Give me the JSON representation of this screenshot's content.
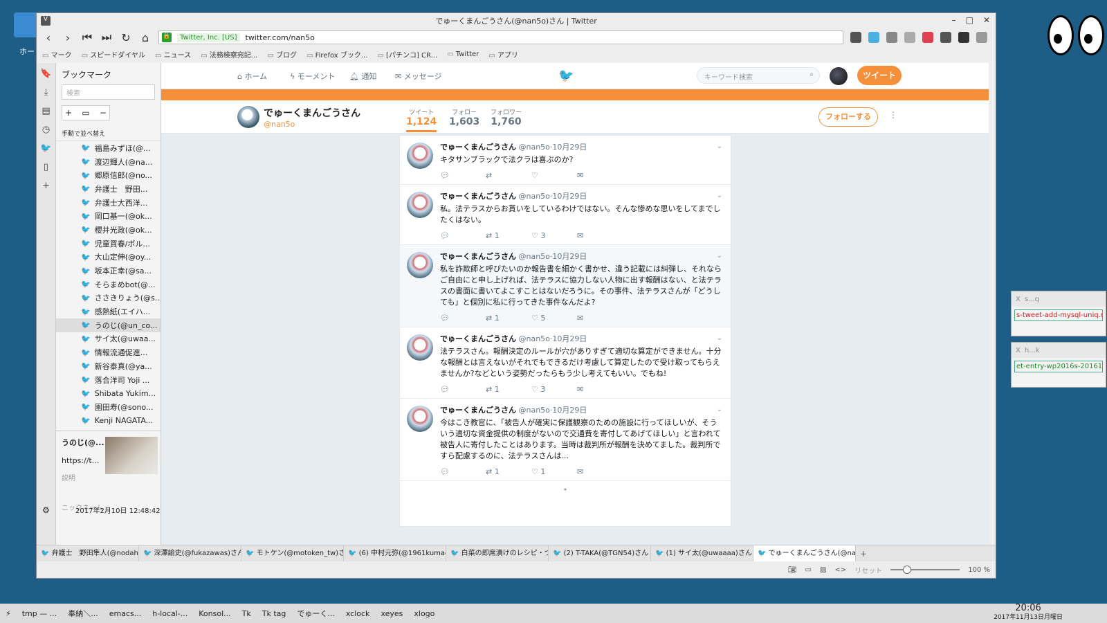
{
  "desktop": {
    "home_label": "ホー"
  },
  "mini_windows": [
    {
      "title": "s...q",
      "content": "s-tweet-add-mysql-uniq.rb"
    },
    {
      "title": "h...k",
      "content": "et-entry-wp2016s-201610"
    }
  ],
  "window": {
    "title": "でゅーくまんごうさん(@nan5o)さん | Twitter",
    "vbadge": "V"
  },
  "address": {
    "cert": "Twitter, Inc. [US]",
    "url": "twitter.com/nan5o"
  },
  "bookmarks": [
    "マーク",
    "スピードダイヤル",
    "ニュース",
    "法務検察宛記...",
    "ブログ",
    "Firefox ブック...",
    "[パチンコ] CR...",
    "Twitter",
    "アプリ"
  ],
  "panel": {
    "title": "ブックマーク",
    "search_placeholder": "検索",
    "sort_label": "手動で並べ替え",
    "items": [
      "福島みずほ(@...",
      "渡辺輝人(@na...",
      "郷原信郎(@no...",
      "弁護士　野田...",
      "弁護士大西洋...",
      "岡口基一(@ok...",
      "櫻井光政(@ok...",
      "児童買春/ポル...",
      "大山定伸(@oy...",
      "坂本正幸(@sa...",
      "そらまめbot(@...",
      "ささきりょう(@s...",
      "感熱紙(エイハ...",
      "うのじ(@un_co...",
      "サイ太(@uwaa...",
      "情報流通促進...",
      "新谷泰真(@ya...",
      "落合洋司 Yoji ...",
      "Shibata Yukim...",
      "園田寿(@sono...",
      "Kenji NAGATA..."
    ],
    "detail_name": "うのじ(@...",
    "detail_url": "https://t...",
    "desc_label": "説明",
    "nick_label": "ニックネーム",
    "date": "2017年2月10日 12:48:42"
  },
  "twitter_nav": {
    "home": "ホーム",
    "moments": "モーメント",
    "notifications": "通知",
    "messages": "メッセージ",
    "search_placeholder": "キーワード検索",
    "tweet_button": "ツイート"
  },
  "profile": {
    "name": "でゅーくまんごうさん",
    "handle": "@nan5o",
    "stats": [
      {
        "label": "ツイート",
        "value": "1,124"
      },
      {
        "label": "フォロー",
        "value": "1,603"
      },
      {
        "label": "フォロワー",
        "value": "1,760"
      }
    ],
    "follow_button": "フォローする"
  },
  "tweets": [
    {
      "name": "でゅーくまんごうさん",
      "handle": "@nan5o",
      "date": "·10月29日",
      "text": "キタサンブラックで法クラは喜ぶのか?",
      "retweets": "",
      "likes": ""
    },
    {
      "name": "でゅーくまんごうさん",
      "handle": "@nan5o",
      "date": "·10月29日",
      "text": "私。法テラスからお貰いをしているわけではない。そんな惨めな思いをしてまでしたくはない。",
      "retweets": "1",
      "likes": "3"
    },
    {
      "name": "でゅーくまんごうさん",
      "handle": "@nan5o",
      "date": "·10月29日",
      "text": "私を詐欺師と呼びたいのか報告書を細かく書かせ、違う記載には糾弾し、それならご自由にと申し上げれば、法テラスに協力しない人物に出す報酬はない、と法テラスの書面に書いてよこすことはないだろうに。その事件、法テラスさんが「どうしても」と個別に私に行ってきた事件なんだよ?",
      "retweets": "1",
      "likes": "5"
    },
    {
      "name": "でゅーくまんごうさん",
      "handle": "@nan5o",
      "date": "·10月29日",
      "text": "法テラスさん。報酬決定のルールが穴がありすぎて適切な算定ができません。十分な報酬とは言えないがそれでもできるだけ考慮して算定したので受け取ってもらえませんか?などという姿勢だったらもう少し考えてもいい。でもね!",
      "retweets": "1",
      "likes": "3"
    },
    {
      "name": "でゅーくまんごうさん",
      "handle": "@nan5o",
      "date": "·10月29日",
      "text": "今はこき教官に、「被告人が確実に保護観察のための施設に行ってほしいが、そういう適切な資金提供の制度がないので交通費を寄付してあげてほしい」と言われて被告人に寄付したことはあります。当時は裁判所が報酬を決めてました。裁判所ですら配慮するのに、法テラスさんは...",
      "retweets": "1",
      "likes": "1"
    }
  ],
  "loader": "•",
  "tabs": [
    "弁護士　野田隼人(@nodaha",
    "深澤諭史(@fukazawas)さん",
    "モトケン(@motoken_tw)さん",
    "(6) 中村元弥(@1961kumach",
    "白菜の即席漬けのレシピ・つく",
    "(2) T-TAKA(@TGN54)さん | T",
    "(1) サイ太(@uwaaaa)さん | Tv",
    "でゅーくまんごうさん(@nan5o"
  ],
  "status": {
    "reset": "リセット",
    "zoom": "100 %"
  },
  "taskbar": {
    "items": [
      "tmp — ...",
      "奉納＼...",
      "emacs...",
      "h-local-...",
      "Konsol...",
      "Tk",
      "Tk tag",
      "でゅーく...",
      "xclock",
      "xeyes",
      "xlogo"
    ],
    "time": "20:06",
    "date": "2017年11月13日月曜日"
  }
}
